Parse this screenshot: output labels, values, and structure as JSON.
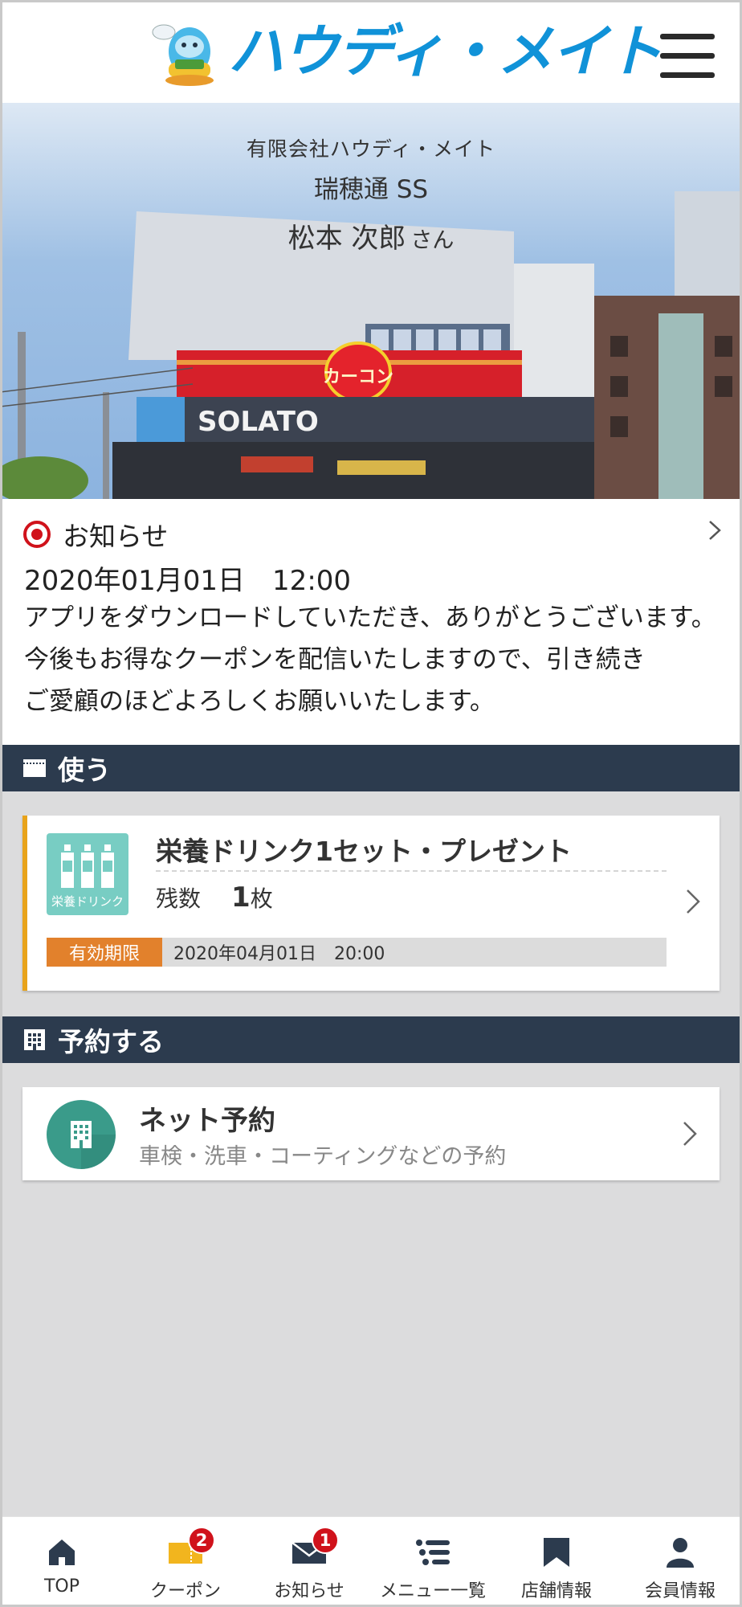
{
  "header": {
    "brand_name": "ハウディ・メイト"
  },
  "hero": {
    "company": "有限会社ハウディ・メイト",
    "store": "瑞穂通 SS",
    "user_name": "松本 次郎",
    "honorific": "さん",
    "sign_solato": "SOLATO",
    "sign_carcon": "カーコン"
  },
  "notice": {
    "title": "お知らせ",
    "datetime": "2020年01月01日　12:00",
    "body_lines": [
      "アプリをダウンロードしていただき、ありがとうございます。",
      "今後もお得なクーポンを配信いたしますので、引き続き",
      "ご愛顧のほどよろしくお願いいたします。"
    ]
  },
  "use_section": {
    "title": "使う"
  },
  "coupon": {
    "image_label": "栄養ドリンク",
    "title": "栄養ドリンク1セット・プレゼント",
    "remaining_label": "残数",
    "remaining_count": "1",
    "remaining_unit": "枚",
    "expiry_label": "有効期限",
    "expiry_date": "2020年04月01日　20:00"
  },
  "reserve_section": {
    "title": "予約する"
  },
  "reserve": {
    "title": "ネット予約",
    "subtitle": "車検・洗車・コーティングなどの予約"
  },
  "bottom_nav": {
    "items": [
      {
        "label": "TOP",
        "icon": "home-icon"
      },
      {
        "label": "クーポン",
        "icon": "coupon-icon",
        "badge": "2"
      },
      {
        "label": "お知らせ",
        "icon": "mail-icon",
        "badge": "1"
      },
      {
        "label": "メニュー一覧",
        "icon": "list-icon"
      },
      {
        "label": "店舗情報",
        "icon": "store-icon"
      },
      {
        "label": "会員情報",
        "icon": "person-icon"
      }
    ]
  },
  "colors": {
    "brand_blue": "#1092d8",
    "section_bar": "#2c3b4e",
    "coupon_accent": "#e8a31a",
    "expiry_orange": "#e2812c",
    "teal": "#3a9b8a",
    "badge_red": "#d0121b"
  }
}
